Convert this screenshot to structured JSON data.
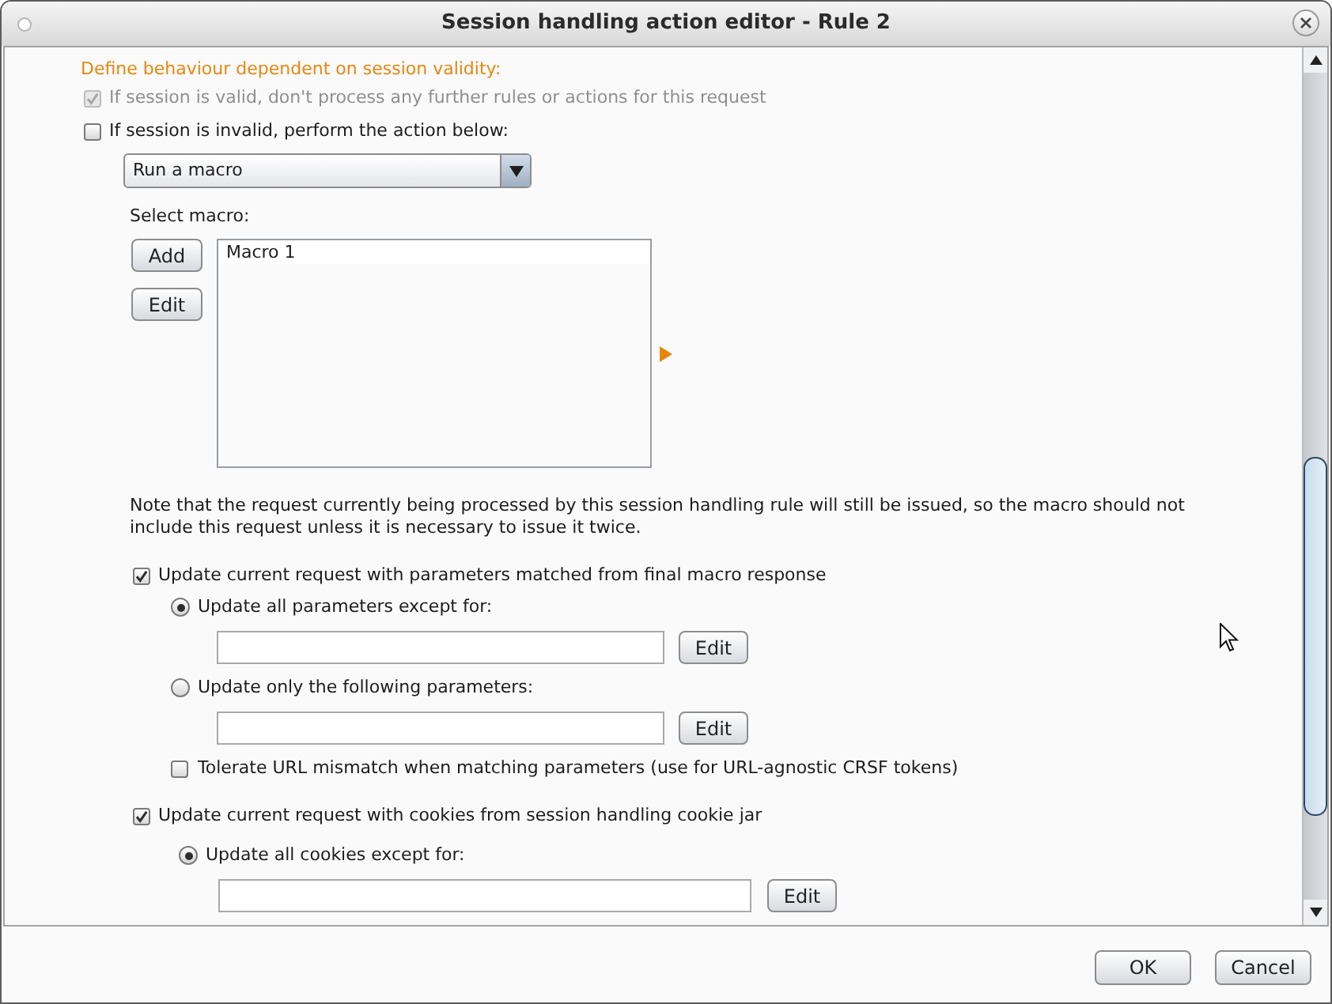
{
  "window": {
    "title": "Session handling action editor - Rule 2"
  },
  "heading": "Define behaviour dependent on session validity:",
  "options": [
    {
      "label": "If session is valid, don't process any further rules or actions for this request",
      "checked": true,
      "disabled": true
    },
    {
      "label": "If session is invalid, perform the action below:",
      "checked": false,
      "disabled": false
    }
  ],
  "action": {
    "value": "Run a macro"
  },
  "macro": {
    "label": "Select macro:",
    "buttons": [
      "Add",
      "Edit"
    ],
    "items": [
      "Macro 1"
    ]
  },
  "note": "Note that the request currently being processed by this session handling rule will still be issued, so the macro should not include this request unless it is necessary to issue it twice.",
  "parameters": {
    "label": "Update current request with parameters matched from final macro response",
    "checked": true,
    "choices": [
      {
        "label": "Update all parameters except for:",
        "selected": true,
        "button": "Edit"
      },
      {
        "label": "Update only the following parameters:",
        "selected": false,
        "button": "Edit"
      }
    ],
    "tolerate": {
      "label": "Tolerate URL mismatch when matching parameters (use for URL-agnostic CRSF tokens)",
      "checked": false
    }
  },
  "cookies": {
    "label": "Update current request with cookies from session handling cookie jar",
    "checked": true,
    "choices": [
      {
        "label": "Update all cookies except for:",
        "selected": true,
        "button": "Edit"
      }
    ]
  },
  "buttons": [
    "OK",
    "Cancel"
  ]
}
